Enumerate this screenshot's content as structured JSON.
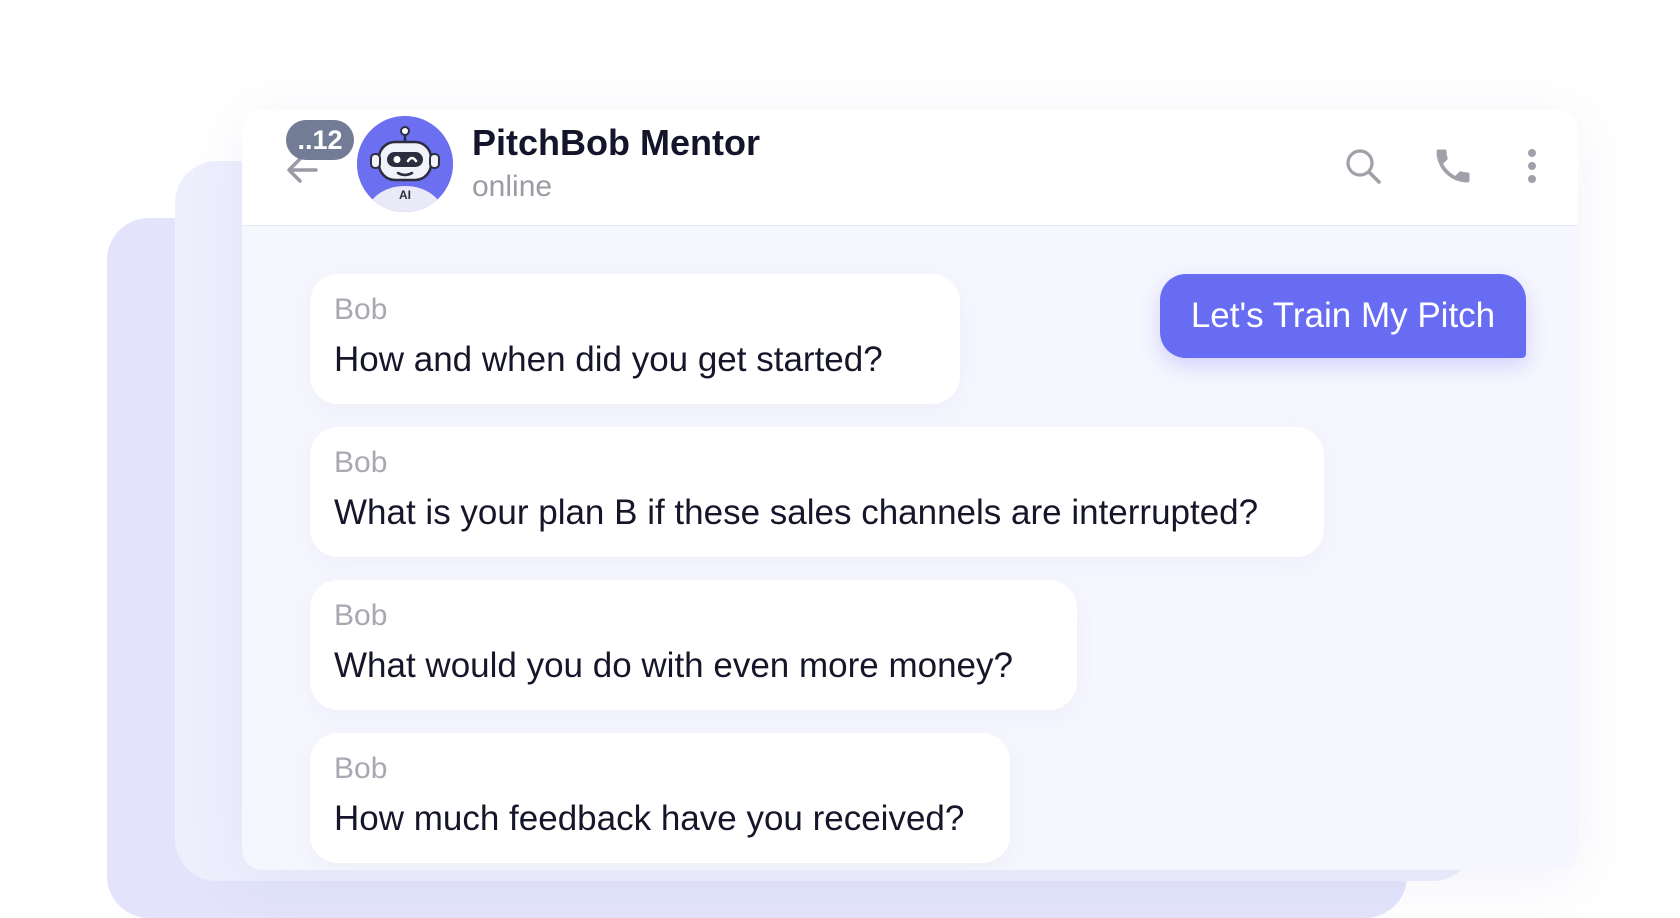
{
  "header": {
    "unread_count": "..12",
    "title": "PitchBob Mentor",
    "status": "online",
    "avatar_label": "AI",
    "icons": [
      "back-arrow-icon",
      "search-icon",
      "phone-icon",
      "more-vertical-icon"
    ]
  },
  "messages": [
    {
      "sender": "Bob",
      "text": "How and when did you get started?"
    },
    {
      "sender": "Bob",
      "text": "What is your plan B if these sales channels are interrupted?"
    },
    {
      "sender": "Bob",
      "text": "What would you do with even more money?"
    },
    {
      "sender": "Bob",
      "text": "How much feedback have you received?"
    }
  ],
  "outgoing": {
    "text": "Let's Train My Pitch"
  },
  "colors": {
    "accent": "#686cf3",
    "badge": "#727c95",
    "chat_background": "#f6f6fe"
  }
}
